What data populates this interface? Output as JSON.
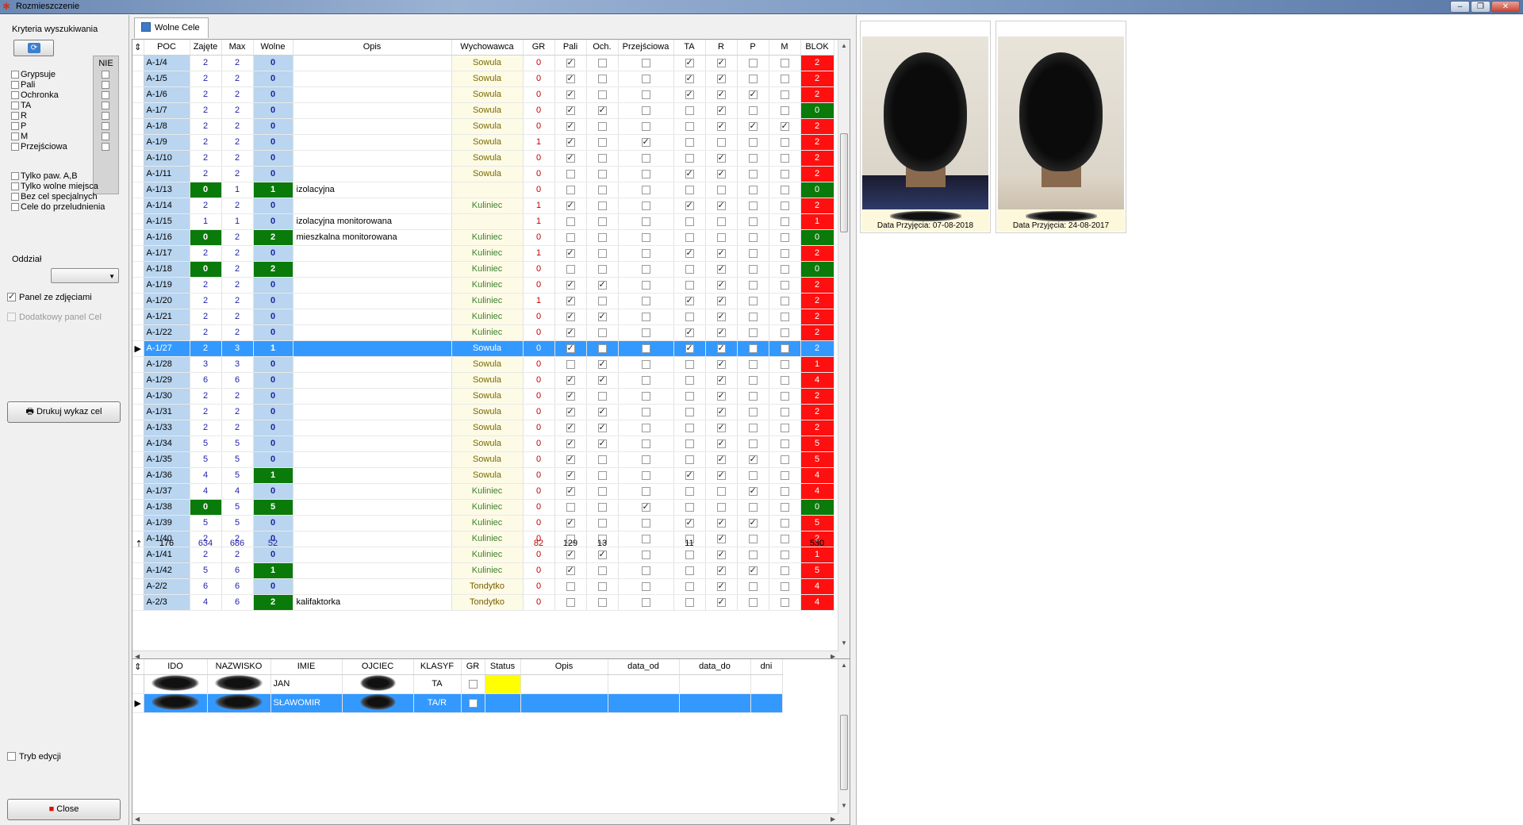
{
  "window": {
    "title": "Rozmieszczenie"
  },
  "left": {
    "criteria_label": "Kryteria wyszukiwania",
    "nie_label": "NIE",
    "filters": [
      {
        "label": "Grypsuje"
      },
      {
        "label": "Pali"
      },
      {
        "label": "Ochronka"
      },
      {
        "label": "TA"
      },
      {
        "label": "R"
      },
      {
        "label": "P"
      },
      {
        "label": "M"
      },
      {
        "label": "Przejściowa"
      }
    ],
    "options": [
      {
        "label": "Tylko paw. A,B"
      },
      {
        "label": "Tylko wolne miejsca"
      },
      {
        "label": "Bez cel specjalnych"
      },
      {
        "label": "Cele do przeludnienia"
      }
    ],
    "oddzial_label": "Oddział",
    "panel_photos_label": "Panel ze zdjęciami",
    "extra_panel_label": "Dodatkowy panel Cel",
    "print_button": "Drukuj wykaz cel",
    "edit_mode_label": "Tryb edycji",
    "close_button": "Close"
  },
  "tab": {
    "label": "Wolne Cele"
  },
  "cells_table": {
    "columns": [
      "POC",
      "Zajęte",
      "Max",
      "Wolne",
      "Opis",
      "Wychowawca",
      "GR",
      "Pali",
      "Och.",
      "Przejściowa",
      "TA",
      "R",
      "P",
      "M",
      "BLOK"
    ],
    "rows": [
      {
        "poc": "A-1/4",
        "zaj": "2",
        "max": "2",
        "wol": "0",
        "opis": "",
        "wych": "Sowula",
        "gr": "0",
        "pali": 1,
        "och": 0,
        "prz": 0,
        "ta": 1,
        "r": 1,
        "p": 0,
        "m": 0,
        "blok": "2",
        "bc": "red"
      },
      {
        "poc": "A-1/5",
        "zaj": "2",
        "max": "2",
        "wol": "0",
        "opis": "",
        "wych": "Sowula",
        "gr": "0",
        "pali": 1,
        "och": 0,
        "prz": 0,
        "ta": 1,
        "r": 1,
        "p": 0,
        "m": 0,
        "blok": "2",
        "bc": "red"
      },
      {
        "poc": "A-1/6",
        "zaj": "2",
        "max": "2",
        "wol": "0",
        "opis": "",
        "wych": "Sowula",
        "gr": "0",
        "pali": 1,
        "och": 0,
        "prz": 0,
        "ta": 1,
        "r": 1,
        "p": 1,
        "m": 0,
        "blok": "2",
        "bc": "red"
      },
      {
        "poc": "A-1/7",
        "zaj": "2",
        "max": "2",
        "wol": "0",
        "opis": "",
        "wych": "Sowula",
        "gr": "0",
        "pali": 1,
        "och": 1,
        "prz": 0,
        "ta": 0,
        "r": 1,
        "p": 0,
        "m": 0,
        "blok": "0",
        "bc": "green"
      },
      {
        "poc": "A-1/8",
        "zaj": "2",
        "max": "2",
        "wol": "0",
        "opis": "",
        "wych": "Sowula",
        "gr": "0",
        "pali": 1,
        "och": 0,
        "prz": 0,
        "ta": 0,
        "r": 1,
        "p": 1,
        "m": 1,
        "blok": "2",
        "bc": "red"
      },
      {
        "poc": "A-1/9",
        "zaj": "2",
        "max": "2",
        "wol": "0",
        "opis": "",
        "wych": "Sowula",
        "gr": "1",
        "pali": 1,
        "och": 0,
        "prz": 1,
        "ta": 0,
        "r": 0,
        "p": 0,
        "m": 0,
        "blok": "2",
        "bc": "red"
      },
      {
        "poc": "A-1/10",
        "zaj": "2",
        "max": "2",
        "wol": "0",
        "opis": "",
        "wych": "Sowula",
        "gr": "0",
        "pali": 1,
        "och": 0,
        "prz": 0,
        "ta": 0,
        "r": 1,
        "p": 0,
        "m": 0,
        "blok": "2",
        "bc": "red"
      },
      {
        "poc": "A-1/11",
        "zaj": "2",
        "max": "2",
        "wol": "0",
        "opis": "",
        "wych": "Sowula",
        "gr": "0",
        "pali": 0,
        "och": 0,
        "prz": 0,
        "ta": 1,
        "r": 1,
        "p": 0,
        "m": 0,
        "blok": "2",
        "bc": "red"
      },
      {
        "poc": "A-1/13",
        "zaj": "0",
        "max": "1",
        "wol": "1",
        "opis": "izolacyjna",
        "wych": "",
        "gr": "0",
        "pali": 0,
        "och": 0,
        "prz": 0,
        "ta": 0,
        "r": 0,
        "p": 0,
        "m": 0,
        "blok": "0",
        "bc": "green",
        "zg": 1,
        "wg": 1
      },
      {
        "poc": "A-1/14",
        "zaj": "2",
        "max": "2",
        "wol": "0",
        "opis": "",
        "wych": "Kuliniec",
        "gr": "1",
        "pali": 1,
        "och": 0,
        "prz": 0,
        "ta": 1,
        "r": 1,
        "p": 0,
        "m": 0,
        "blok": "2",
        "bc": "red"
      },
      {
        "poc": "A-1/15",
        "zaj": "1",
        "max": "1",
        "wol": "0",
        "opis": "izolacyjna monitorowana",
        "wych": "",
        "gr": "1",
        "pali": 0,
        "och": 0,
        "prz": 0,
        "ta": 0,
        "r": 0,
        "p": 0,
        "m": 0,
        "blok": "1",
        "bc": "red"
      },
      {
        "poc": "A-1/16",
        "zaj": "0",
        "max": "2",
        "wol": "2",
        "opis": "mieszkalna monitorowana",
        "wych": "Kuliniec",
        "gr": "0",
        "pali": 0,
        "och": 0,
        "prz": 0,
        "ta": 0,
        "r": 0,
        "p": 0,
        "m": 0,
        "blok": "0",
        "bc": "green",
        "zg": 1,
        "wg": 1
      },
      {
        "poc": "A-1/17",
        "zaj": "2",
        "max": "2",
        "wol": "0",
        "opis": "",
        "wych": "Kuliniec",
        "gr": "1",
        "pali": 1,
        "och": 0,
        "prz": 0,
        "ta": 1,
        "r": 1,
        "p": 0,
        "m": 0,
        "blok": "2",
        "bc": "red"
      },
      {
        "poc": "A-1/18",
        "zaj": "0",
        "max": "2",
        "wol": "2",
        "opis": "",
        "wych": "Kuliniec",
        "gr": "0",
        "pali": 0,
        "och": 0,
        "prz": 0,
        "ta": 0,
        "r": 1,
        "p": 0,
        "m": 0,
        "blok": "0",
        "bc": "green",
        "zg": 1,
        "wg": 1
      },
      {
        "poc": "A-1/19",
        "zaj": "2",
        "max": "2",
        "wol": "0",
        "opis": "",
        "wych": "Kuliniec",
        "gr": "0",
        "pali": 1,
        "och": 1,
        "prz": 0,
        "ta": 0,
        "r": 1,
        "p": 0,
        "m": 0,
        "blok": "2",
        "bc": "red"
      },
      {
        "poc": "A-1/20",
        "zaj": "2",
        "max": "2",
        "wol": "0",
        "opis": "",
        "wych": "Kuliniec",
        "gr": "1",
        "pali": 1,
        "och": 0,
        "prz": 0,
        "ta": 1,
        "r": 1,
        "p": 0,
        "m": 0,
        "blok": "2",
        "bc": "red"
      },
      {
        "poc": "A-1/21",
        "zaj": "2",
        "max": "2",
        "wol": "0",
        "opis": "",
        "wych": "Kuliniec",
        "gr": "0",
        "pali": 1,
        "och": 1,
        "prz": 0,
        "ta": 0,
        "r": 1,
        "p": 0,
        "m": 0,
        "blok": "2",
        "bc": "red"
      },
      {
        "poc": "A-1/22",
        "zaj": "2",
        "max": "2",
        "wol": "0",
        "opis": "",
        "wych": "Kuliniec",
        "gr": "0",
        "pali": 1,
        "och": 0,
        "prz": 0,
        "ta": 1,
        "r": 1,
        "p": 0,
        "m": 0,
        "blok": "2",
        "bc": "red"
      },
      {
        "poc": "A-1/27",
        "zaj": "2",
        "max": "3",
        "wol": "1",
        "opis": "",
        "wych": "Sowula",
        "gr": "0",
        "pali": 1,
        "och": 0,
        "prz": 0,
        "ta": 1,
        "r": 1,
        "p": 0,
        "m": 0,
        "blok": "2",
        "bc": "red",
        "sel": 1
      },
      {
        "poc": "A-1/28",
        "zaj": "3",
        "max": "3",
        "wol": "0",
        "opis": "",
        "wych": "Sowula",
        "gr": "0",
        "pali": 0,
        "och": 1,
        "prz": 0,
        "ta": 0,
        "r": 1,
        "p": 0,
        "m": 0,
        "blok": "1",
        "bc": "red"
      },
      {
        "poc": "A-1/29",
        "zaj": "6",
        "max": "6",
        "wol": "0",
        "opis": "",
        "wych": "Sowula",
        "gr": "0",
        "pali": 1,
        "och": 1,
        "prz": 0,
        "ta": 0,
        "r": 1,
        "p": 0,
        "m": 0,
        "blok": "4",
        "bc": "red"
      },
      {
        "poc": "A-1/30",
        "zaj": "2",
        "max": "2",
        "wol": "0",
        "opis": "",
        "wych": "Sowula",
        "gr": "0",
        "pali": 1,
        "och": 0,
        "prz": 0,
        "ta": 0,
        "r": 1,
        "p": 0,
        "m": 0,
        "blok": "2",
        "bc": "red"
      },
      {
        "poc": "A-1/31",
        "zaj": "2",
        "max": "2",
        "wol": "0",
        "opis": "",
        "wych": "Sowula",
        "gr": "0",
        "pali": 1,
        "och": 1,
        "prz": 0,
        "ta": 0,
        "r": 1,
        "p": 0,
        "m": 0,
        "blok": "2",
        "bc": "red"
      },
      {
        "poc": "A-1/33",
        "zaj": "2",
        "max": "2",
        "wol": "0",
        "opis": "",
        "wych": "Sowula",
        "gr": "0",
        "pali": 1,
        "och": 1,
        "prz": 0,
        "ta": 0,
        "r": 1,
        "p": 0,
        "m": 0,
        "blok": "2",
        "bc": "red"
      },
      {
        "poc": "A-1/34",
        "zaj": "5",
        "max": "5",
        "wol": "0",
        "opis": "",
        "wych": "Sowula",
        "gr": "0",
        "pali": 1,
        "och": 1,
        "prz": 0,
        "ta": 0,
        "r": 1,
        "p": 0,
        "m": 0,
        "blok": "5",
        "bc": "red"
      },
      {
        "poc": "A-1/35",
        "zaj": "5",
        "max": "5",
        "wol": "0",
        "opis": "",
        "wych": "Sowula",
        "gr": "0",
        "pali": 1,
        "och": 0,
        "prz": 0,
        "ta": 0,
        "r": 1,
        "p": 1,
        "m": 0,
        "blok": "5",
        "bc": "red"
      },
      {
        "poc": "A-1/36",
        "zaj": "4",
        "max": "5",
        "wol": "1",
        "opis": "",
        "wych": "Sowula",
        "gr": "0",
        "pali": 1,
        "och": 0,
        "prz": 0,
        "ta": 1,
        "r": 1,
        "p": 0,
        "m": 0,
        "blok": "4",
        "bc": "red",
        "wg": 1
      },
      {
        "poc": "A-1/37",
        "zaj": "4",
        "max": "4",
        "wol": "0",
        "opis": "",
        "wych": "Kuliniec",
        "gr": "0",
        "pali": 1,
        "och": 0,
        "prz": 0,
        "ta": 0,
        "r": 0,
        "p": 1,
        "m": 0,
        "blok": "4",
        "bc": "red"
      },
      {
        "poc": "A-1/38",
        "zaj": "0",
        "max": "5",
        "wol": "5",
        "opis": "",
        "wych": "Kuliniec",
        "gr": "0",
        "pali": 0,
        "och": 0,
        "prz": 1,
        "ta": 0,
        "r": 0,
        "p": 0,
        "m": 0,
        "blok": "0",
        "bc": "green",
        "zg": 1,
        "wg": 1
      },
      {
        "poc": "A-1/39",
        "zaj": "5",
        "max": "5",
        "wol": "0",
        "opis": "",
        "wych": "Kuliniec",
        "gr": "0",
        "pali": 1,
        "och": 0,
        "prz": 0,
        "ta": 1,
        "r": 1,
        "p": 1,
        "m": 0,
        "blok": "5",
        "bc": "red"
      },
      {
        "poc": "A-1/40",
        "zaj": "2",
        "max": "2",
        "wol": "0",
        "opis": "",
        "wych": "Kuliniec",
        "gr": "0",
        "pali": 0,
        "och": 0,
        "prz": 0,
        "ta": 0,
        "r": 1,
        "p": 0,
        "m": 0,
        "blok": "2",
        "bc": "red"
      },
      {
        "poc": "A-1/41",
        "zaj": "2",
        "max": "2",
        "wol": "0",
        "opis": "",
        "wych": "Kuliniec",
        "gr": "0",
        "pali": 1,
        "och": 1,
        "prz": 0,
        "ta": 0,
        "r": 1,
        "p": 0,
        "m": 0,
        "blok": "1",
        "bc": "red"
      },
      {
        "poc": "A-1/42",
        "zaj": "5",
        "max": "6",
        "wol": "1",
        "opis": "",
        "wych": "Kuliniec",
        "gr": "0",
        "pali": 1,
        "och": 0,
        "prz": 0,
        "ta": 0,
        "r": 1,
        "p": 1,
        "m": 0,
        "blok": "5",
        "bc": "red",
        "wg": 1
      },
      {
        "poc": "A-2/2",
        "zaj": "6",
        "max": "6",
        "wol": "0",
        "opis": "",
        "wych": "Tondytko",
        "gr": "0",
        "pali": 0,
        "och": 0,
        "prz": 0,
        "ta": 0,
        "r": 1,
        "p": 0,
        "m": 0,
        "blok": "4",
        "bc": "red"
      },
      {
        "poc": "A-2/3",
        "zaj": "4",
        "max": "6",
        "wol": "2",
        "opis": "kalifaktorka",
        "wych": "Tondytko",
        "gr": "0",
        "pali": 0,
        "och": 0,
        "prz": 0,
        "ta": 0,
        "r": 1,
        "p": 0,
        "m": 0,
        "blok": "4",
        "bc": "red",
        "wg": 1
      }
    ],
    "totals": {
      "poc": "176",
      "zaj": "634",
      "max": "686",
      "wol": "52",
      "gr": "82",
      "pali": "129",
      "och": "13",
      "ta": "11",
      "blok": "530"
    }
  },
  "persons_table": {
    "columns": [
      "IDO",
      "NAZWISKO",
      "IMIE",
      "OJCIEC",
      "KLASYF",
      "GR",
      "Status",
      "Opis",
      "data_od",
      "data_do",
      "dni"
    ],
    "rows": [
      {
        "imie": "JAN",
        "klasyf": "TA",
        "sel": 0
      },
      {
        "imie": "SŁAWOMIR",
        "klasyf": "TA/R",
        "sel": 1
      }
    ]
  },
  "photos": [
    {
      "caption": "Data Przyjęcia: 07-08-2018"
    },
    {
      "caption": "Data Przyjęcia: 24-08-2017"
    }
  ]
}
